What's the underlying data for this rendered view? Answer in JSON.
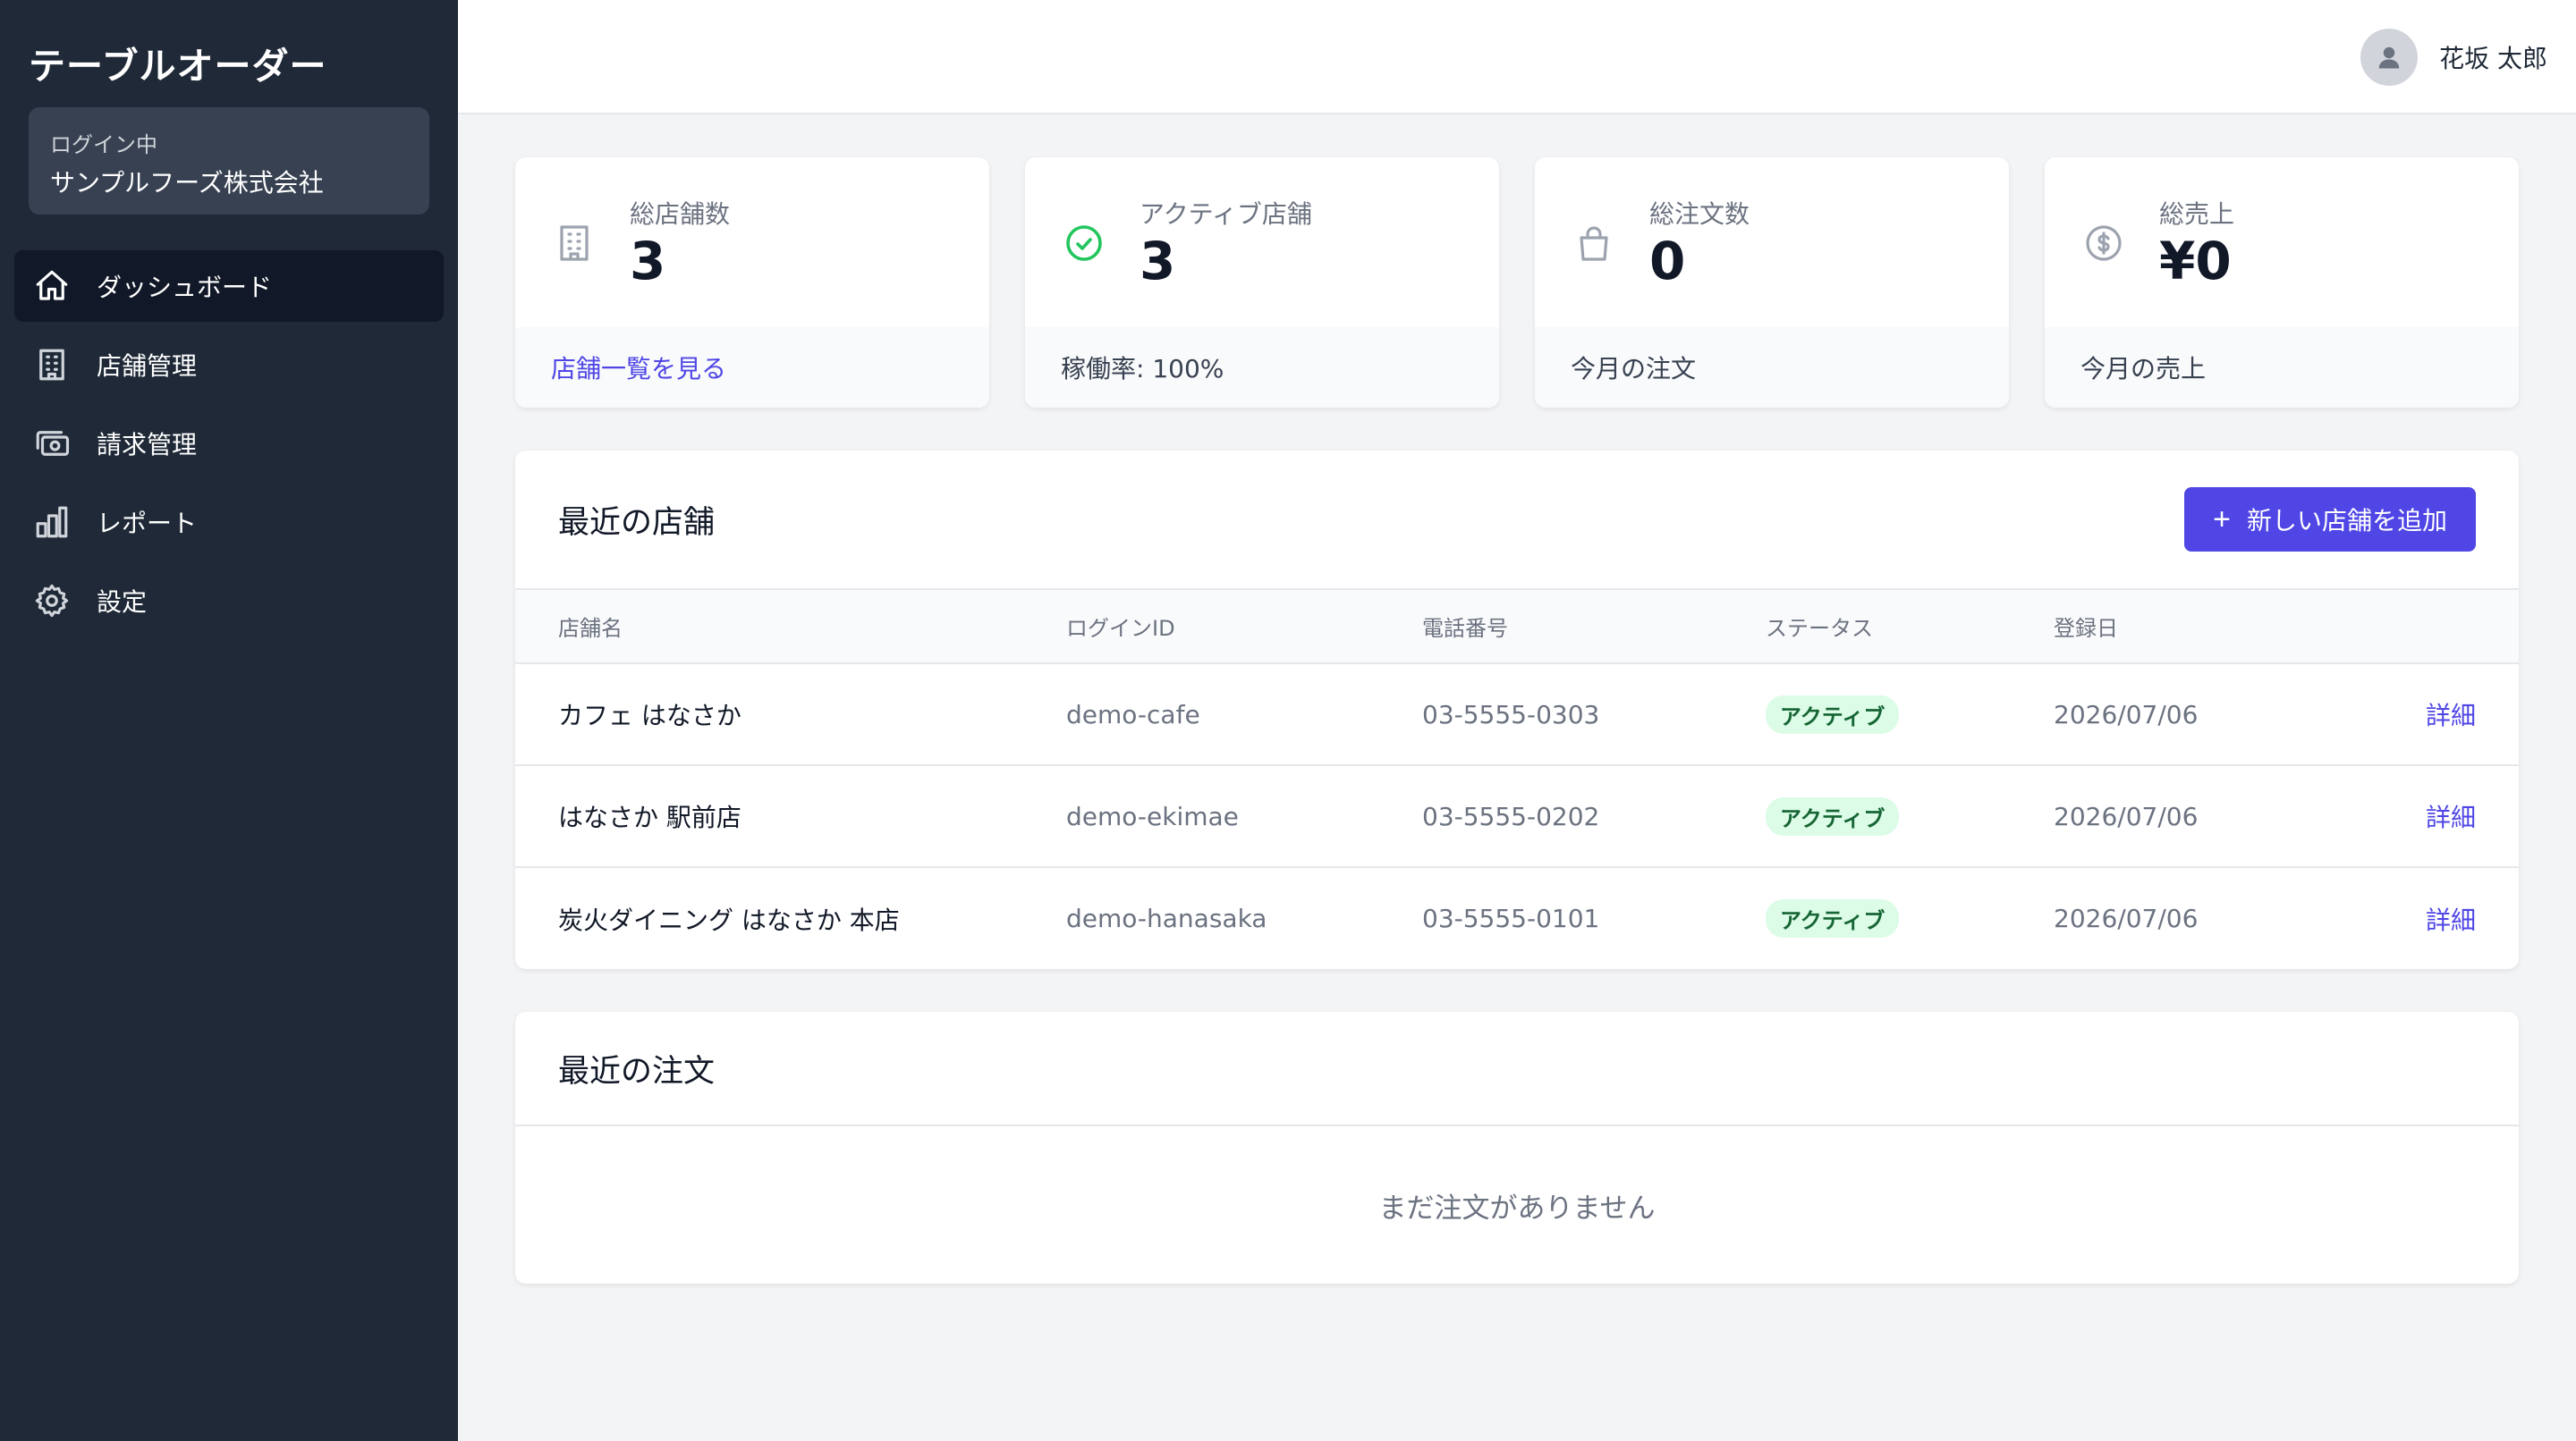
{
  "sidebar": {
    "brand": "テーブルオーダー",
    "login_label": "ログイン中",
    "organization": "サンプルフーズ株式会社",
    "items": [
      {
        "label": "ダッシュボード",
        "icon": "home-icon",
        "active": true
      },
      {
        "label": "店舗管理",
        "icon": "building-icon"
      },
      {
        "label": "請求管理",
        "icon": "billing-icon"
      },
      {
        "label": "レポート",
        "icon": "chart-bar-icon"
      },
      {
        "label": "設定",
        "icon": "gear-icon"
      }
    ]
  },
  "header": {
    "user_name": "花坂 太郎"
  },
  "stats": [
    {
      "label": "総店舗数",
      "value": "3",
      "footer": "店舗一覧を見る",
      "icon": "building-icon"
    },
    {
      "label": "アクティブ店舗",
      "value": "3",
      "footer": "稼働率: 100%",
      "icon": "check-circle-icon"
    },
    {
      "label": "総注文数",
      "value": "0",
      "footer": "今月の注文",
      "icon": "shopping-bag-icon"
    },
    {
      "label": "総売上",
      "value": "¥0",
      "footer": "今月の売上",
      "icon": "dollar-circle-icon"
    }
  ],
  "stores": {
    "title": "最近の店舗",
    "add_button": "新しい店舗を追加",
    "columns": [
      "店舗名",
      "ログインID",
      "電話番号",
      "ステータス",
      "登録日"
    ],
    "rows": [
      {
        "name": "カフェ はなさか",
        "login_id": "demo-cafe",
        "phone": "03-5555-0303",
        "status": "アクティブ",
        "date": "2026/07/06",
        "action": "詳細"
      },
      {
        "name": "はなさか 駅前店",
        "login_id": "demo-ekimae",
        "phone": "03-5555-0202",
        "status": "アクティブ",
        "date": "2026/07/06",
        "action": "詳細"
      },
      {
        "name": "炭火ダイニング はなさか 本店",
        "login_id": "demo-hanasaka",
        "phone": "03-5555-0101",
        "status": "アクティブ",
        "date": "2026/07/06",
        "action": "詳細"
      }
    ]
  },
  "orders": {
    "title": "最近の注文",
    "empty_text": "まだ注文がありません"
  },
  "colors": {
    "sidebar_bg": "#1f2937",
    "accent": "#4f46e5",
    "active_badge_bg": "#dcfce7",
    "active_badge_text": "#166534",
    "success_icon": "#22c55e"
  }
}
